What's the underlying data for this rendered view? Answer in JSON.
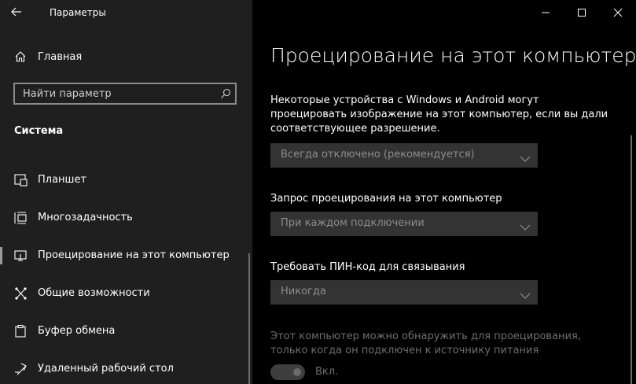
{
  "window": {
    "title": "Параметры",
    "controls": [
      "minimize-icon",
      "maximize-icon",
      "close-icon"
    ]
  },
  "sidebar": {
    "home_label": "Главная",
    "search_placeholder": "Найти параметр",
    "section_title": "Система",
    "items": [
      {
        "label": "Планшет",
        "icon": "tablet-icon"
      },
      {
        "label": "Многозадачность",
        "icon": "multitasking-icon"
      },
      {
        "label": "Проецирование на этот компьютер",
        "icon": "projecting-icon",
        "selected": true
      },
      {
        "label": "Общие возможности",
        "icon": "shared-experiences-icon"
      },
      {
        "label": "Буфер обмена",
        "icon": "clipboard-icon"
      },
      {
        "label": "Удаленный рабочий стол",
        "icon": "remote-desktop-icon"
      }
    ]
  },
  "main": {
    "heading": "Проецирование на этот компьютер",
    "description": "Некоторые устройства с Windows и Android могут проецировать изображение на этот компьютер, если вы дали соответствующее разрешение.",
    "dropdown_availability": "Всегда отключено (рекомендуется)",
    "request_label": "Запрос проецирования на этот компьютер",
    "dropdown_request": "При каждом подключении",
    "pin_label": "Требовать ПИН-код для связывания",
    "dropdown_pin": "Никогда",
    "power_note": "Этот компьютер можно обнаружить для проецирования, только когда он подключен к источнику питания",
    "toggle_label": "Вкл."
  },
  "colors": {
    "sidebar_bg": "#1f1f1f",
    "main_bg": "#000000",
    "dropdown_bg": "#333333",
    "disabled_text": "#6d6d6d"
  }
}
